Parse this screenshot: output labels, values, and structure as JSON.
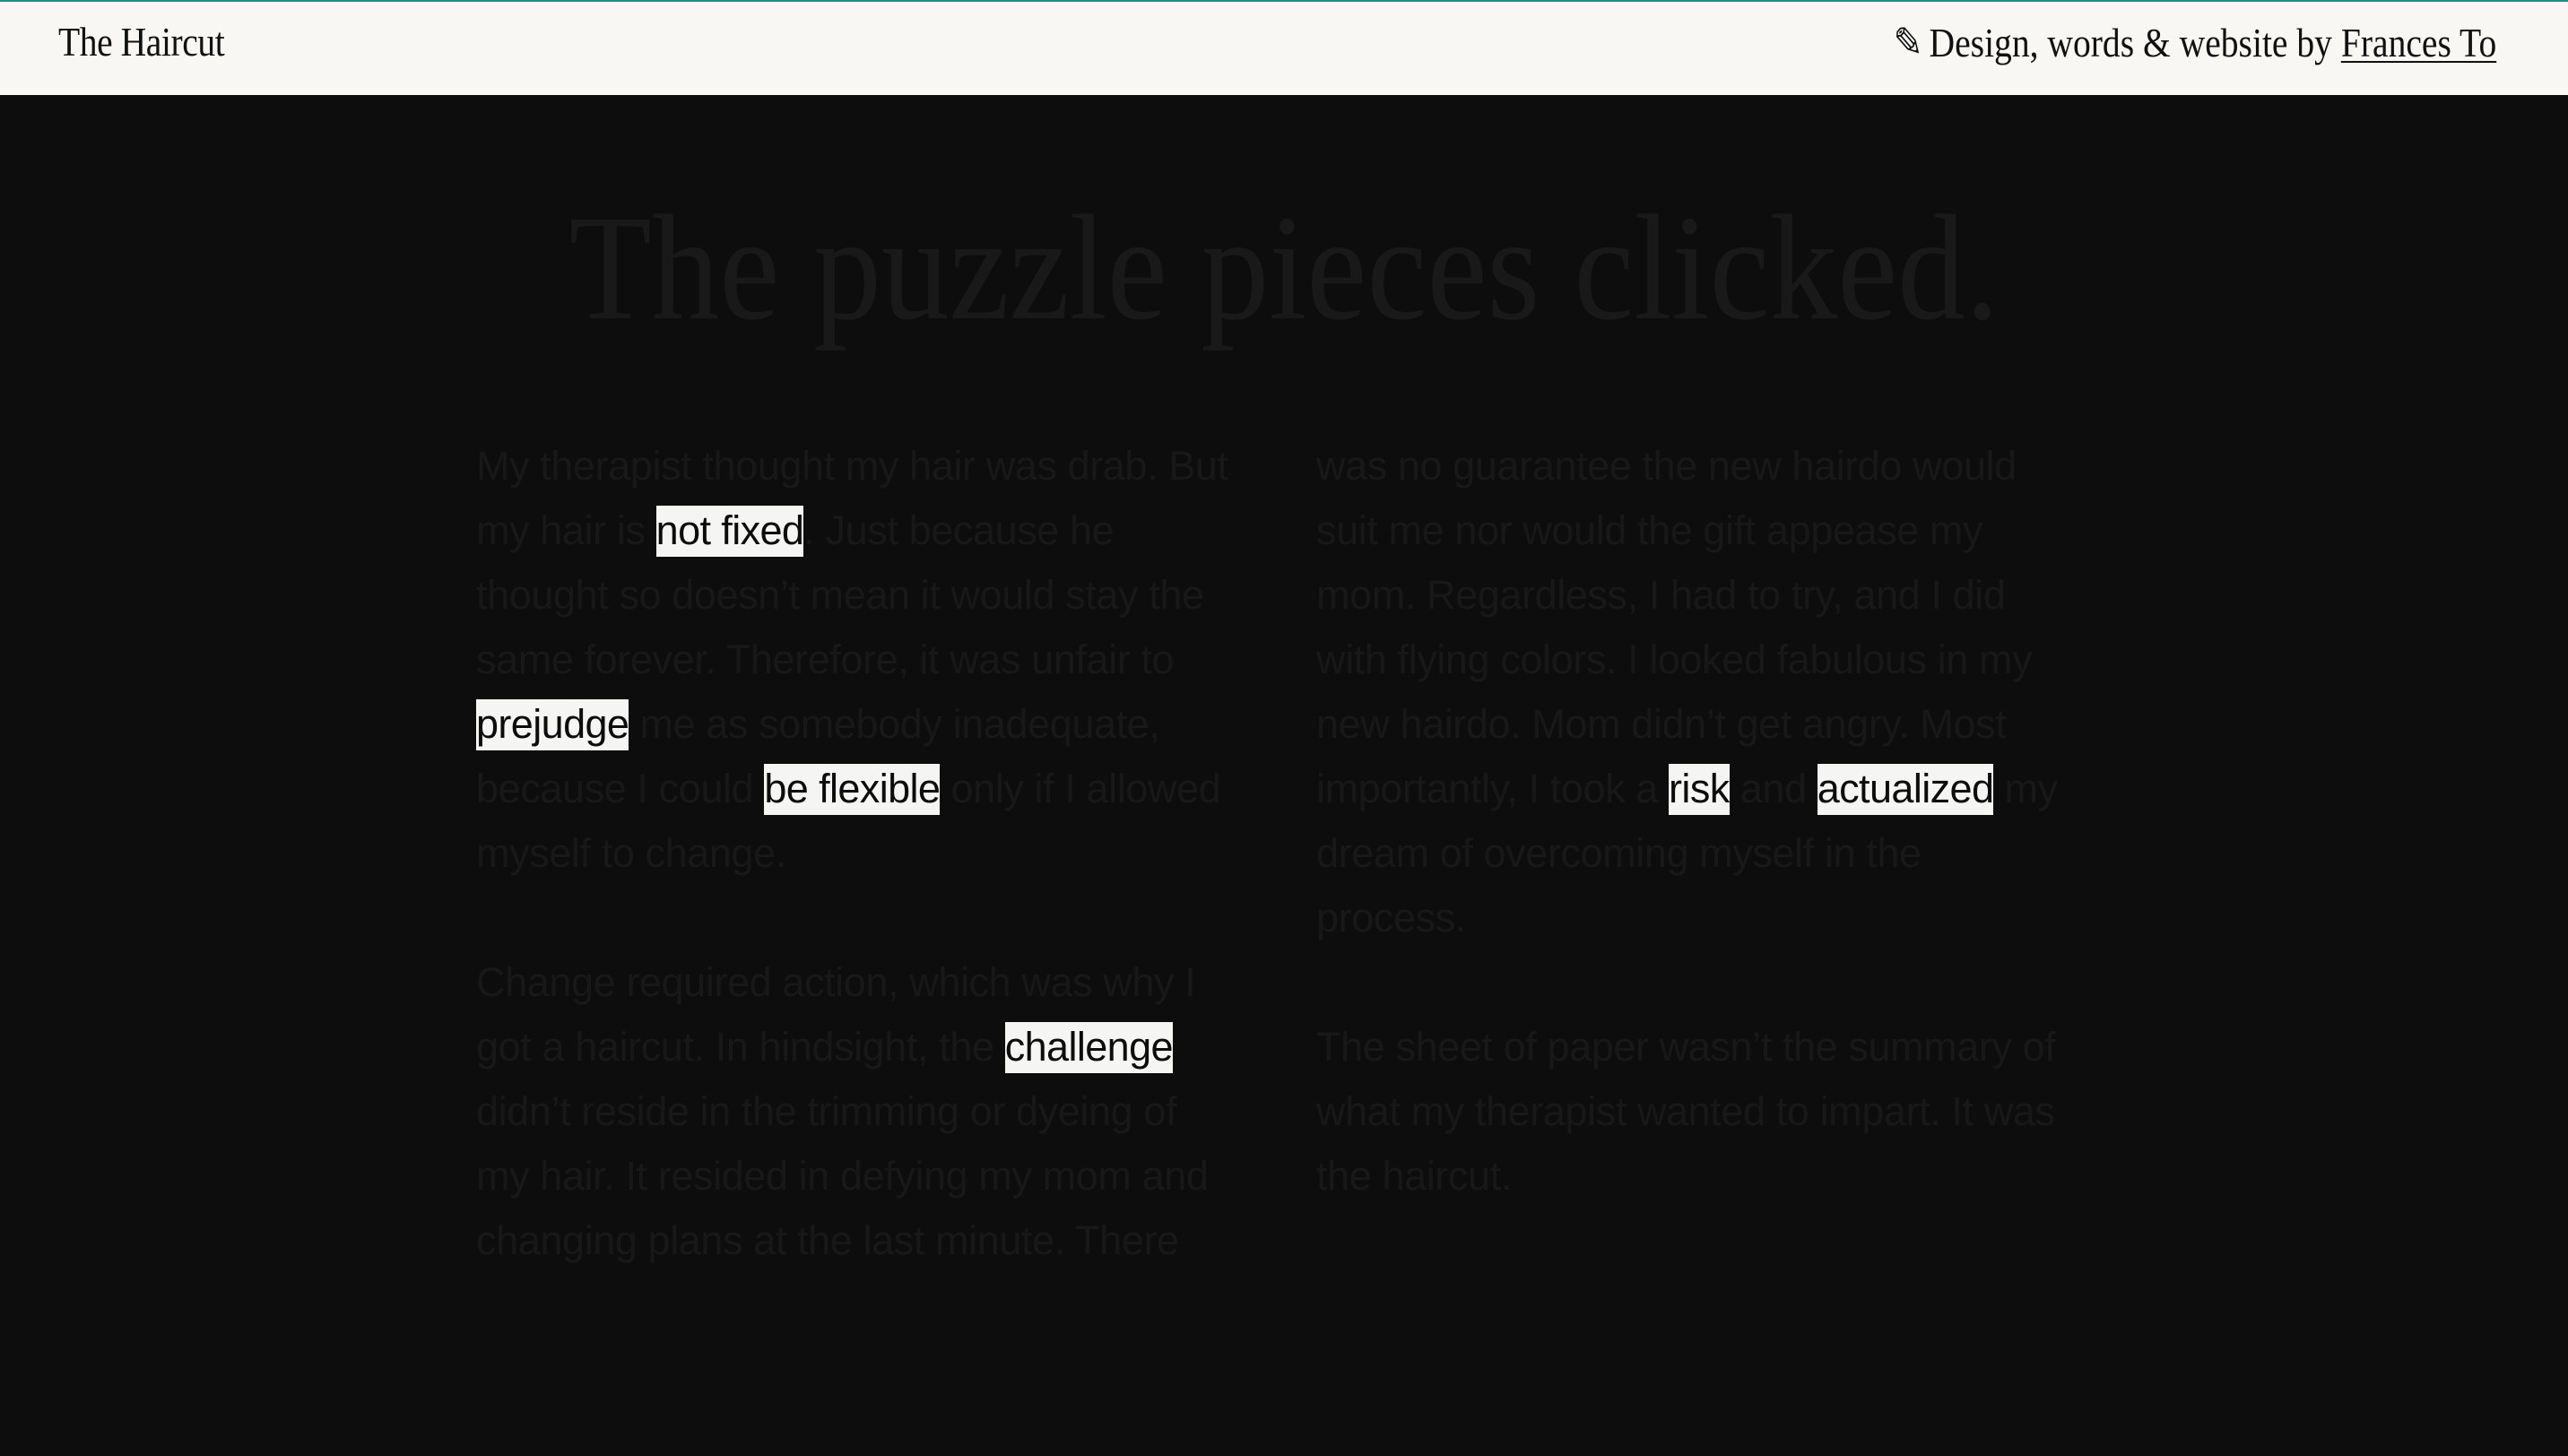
{
  "header": {
    "site_title": "The Haircut",
    "credits_prefix": "Design, words & website by",
    "credits_author": "Frances To",
    "pencil_icon": "✎"
  },
  "headline": "The puzzle pieces clicked.",
  "article": {
    "col1_p1": [
      "My therapist thought my hair was drab. But my hair is ",
      "not fixed",
      ". Just because he thought so doesn’t mean it would stay the same forever. Therefore, it was unfair to ",
      "prejudge",
      " me as somebody inadequate, because I could ",
      "be flexible",
      " only if I allowed myself to change."
    ],
    "col1_p2": [
      "Change required action, which was why I got a haircut. In hindsight, the ",
      "challenge",
      " didn’t reside in the trimming or dyeing of my hair. It resided in defying my mom and changing plans at the last minute. There"
    ],
    "col2_p1": [
      "was no guarantee the new hairdo would suit me nor would the gift appease my mom. Regardless, I had to try, and I did with flying colors. I looked fabulous in my new hairdo. Mom didn’t get angry. Most importantly, I took a ",
      "risk",
      " and ",
      "actualized",
      " my dream of overcoming myself in the process."
    ],
    "col2_p2": [
      "The sheet of paper wasn’t the summary of what my therapist wanted to impart. It was the haircut."
    ]
  },
  "colors": {
    "background": "#0d0d0d",
    "header_bg": "#f8f7f3",
    "progress": "#2a8a86",
    "highlight_bg": "#f5f5f3",
    "muted_text": "#181818"
  },
  "reading_progress_percent": 89
}
